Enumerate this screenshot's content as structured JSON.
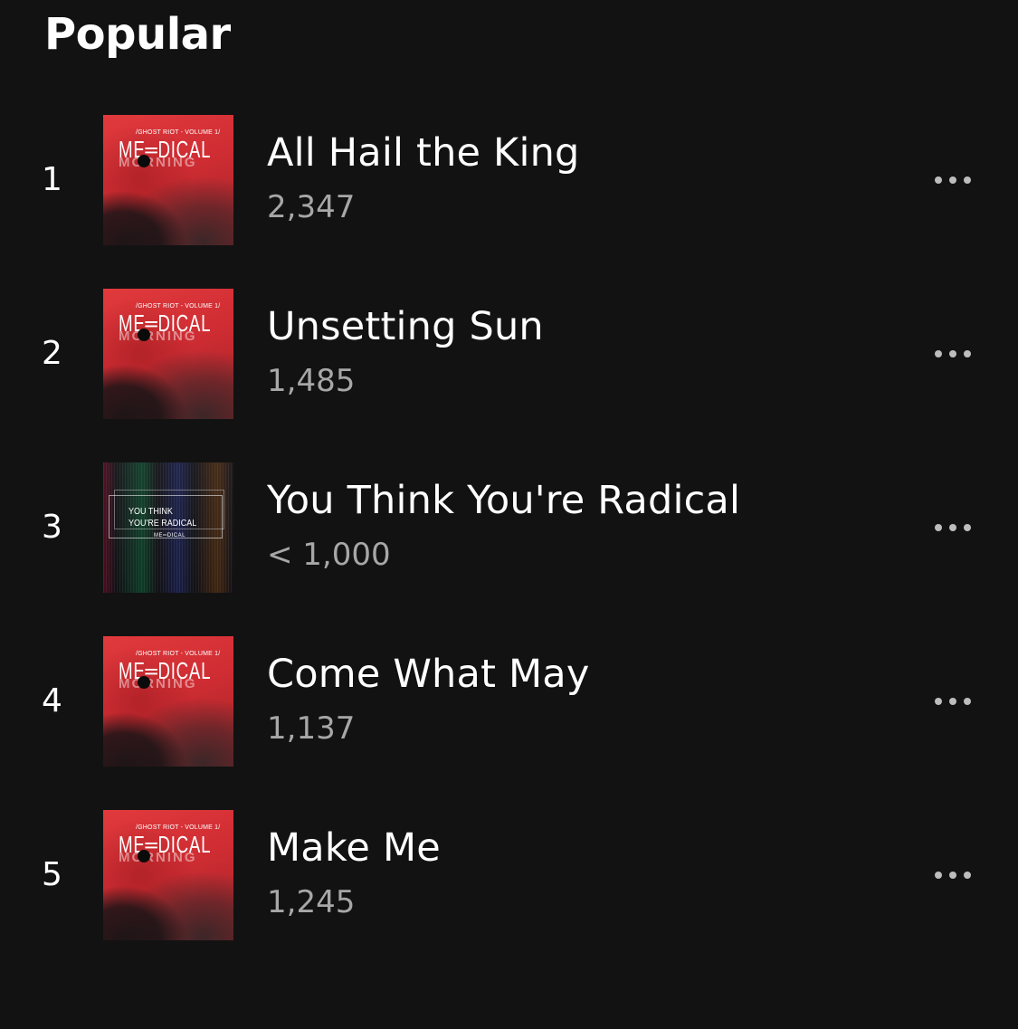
{
  "section": {
    "title": "Popular"
  },
  "tracks": [
    {
      "rank": "1",
      "title": "All Hail the King",
      "plays": "2,347",
      "cover": {
        "style": "red",
        "subtitle": "/GHOST RIOT - VOLUME 1/",
        "band_top": "ME═DICAL",
        "band_bottom": "MORNING"
      },
      "more_icon": "more-horizontal-icon"
    },
    {
      "rank": "2",
      "title": "Unsetting Sun",
      "plays": "1,485",
      "cover": {
        "style": "red",
        "subtitle": "/GHOST RIOT - VOLUME 1/",
        "band_top": "ME═DICAL",
        "band_bottom": "MORNING"
      },
      "more_icon": "more-horizontal-icon"
    },
    {
      "rank": "3",
      "title": "You Think You're Radical",
      "plays": "< 1,000",
      "cover": {
        "style": "dark",
        "text": "YOU THINK\nYOU'RE RADICAL",
        "mini": "ME═DICAL"
      },
      "more_icon": "more-horizontal-icon"
    },
    {
      "rank": "4",
      "title": "Come What May",
      "plays": "1,137",
      "cover": {
        "style": "red",
        "subtitle": "/GHOST RIOT - VOLUME 1/",
        "band_top": "ME═DICAL",
        "band_bottom": "MORNING"
      },
      "more_icon": "more-horizontal-icon"
    },
    {
      "rank": "5",
      "title": "Make Me",
      "plays": "1,245",
      "cover": {
        "style": "red",
        "subtitle": "/GHOST RIOT - VOLUME 1/",
        "band_top": "ME═DICAL",
        "band_bottom": "MORNING"
      },
      "more_icon": "more-horizontal-icon"
    }
  ],
  "colors": {
    "background": "#121212",
    "primary_text": "#ffffff",
    "secondary_text": "#a7a7a7",
    "icon": "#bdbdbd"
  }
}
